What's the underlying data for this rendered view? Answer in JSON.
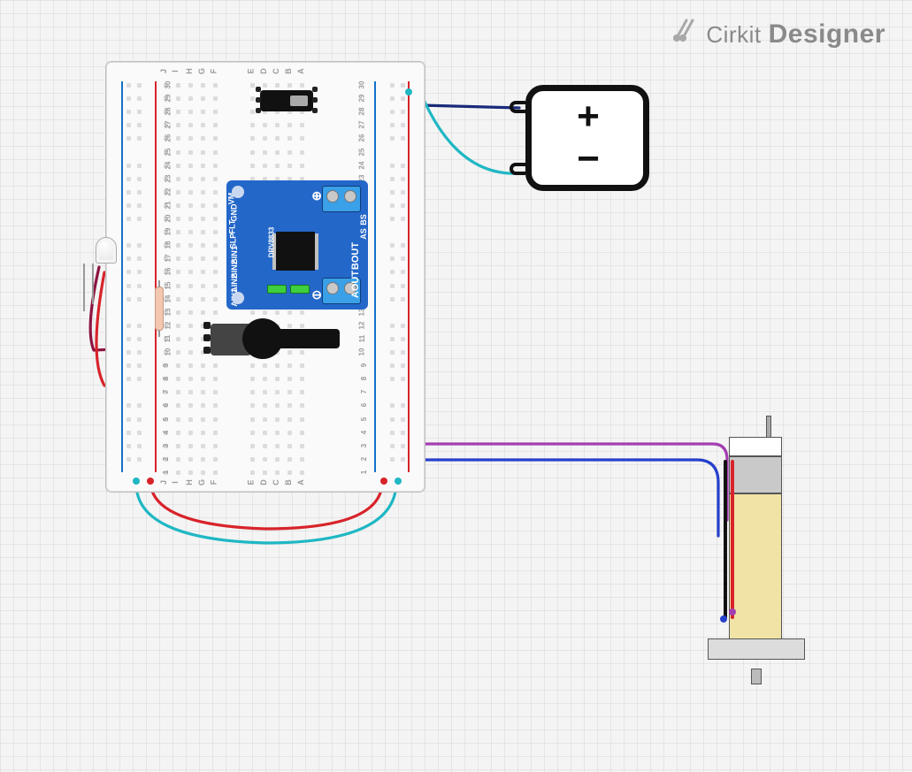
{
  "app": {
    "brand_prefix": "Cirkit",
    "brand_suffix": "Designer"
  },
  "breadboard": {
    "rows_start": 1,
    "rows_end": 30,
    "col_top_labels": [
      "J",
      "I",
      "H",
      "G",
      "F",
      "E",
      "D",
      "C",
      "B",
      "A"
    ],
    "col_bottom_labels": [
      "J",
      "I",
      "H",
      "G",
      "F",
      "E",
      "D",
      "C",
      "B",
      "A"
    ]
  },
  "components": {
    "battery": {
      "plus": "+",
      "minus": "−"
    },
    "driver": {
      "chip_label": "DRV8833",
      "top_pins": [
        "VM",
        "GND",
        "FLT",
        "SLP",
        "BIN1",
        "BIN2",
        "AIN2",
        "AIN1"
      ],
      "bot_pins": [
        "BS",
        "AS",
        "BOUT",
        "AOUT"
      ],
      "term_top_label": "⊕",
      "term_bot_label": "⊖"
    },
    "led": {
      "color": "clear"
    },
    "resistor": {
      "value_ohms": "unlabeled"
    },
    "potentiometer": {
      "type": "rotary"
    },
    "switch": {
      "poles": "3-pin slide"
    },
    "motor": {
      "type": "geared DC hobby motor"
    }
  },
  "wires": {
    "colors": {
      "red": "#d8232a",
      "teal": "#1fb7c4",
      "navy": "#1a2a7a",
      "blue": "#2640cc",
      "purple": "#a33fb1",
      "maroon": "#8d1441",
      "black": "#111",
      "pink": "#e86fb6"
    }
  }
}
